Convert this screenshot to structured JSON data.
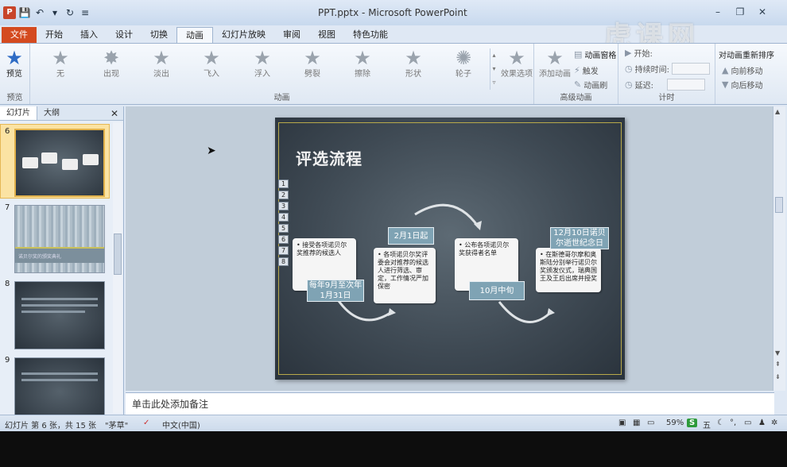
{
  "window": {
    "title": "PPT.pptx - Microsoft PowerPoint",
    "controls": [
      "–",
      "❐",
      "✕"
    ],
    "watermark": "虎课网"
  },
  "tabs": [
    "文件",
    "开始",
    "插入",
    "设计",
    "切换",
    "动画",
    "幻灯片放映",
    "审阅",
    "视图",
    "特色功能"
  ],
  "active_tab": "动画",
  "ribbon": {
    "preview_label": "预览",
    "preview_group": "预览",
    "animation_group": "动画",
    "animations": [
      "无",
      "出现",
      "淡出",
      "飞入",
      "浮入",
      "劈裂",
      "擦除",
      "形状",
      "轮子"
    ],
    "effect_options": "效果选项",
    "advanced_group": "高级动画",
    "add_animation": "添加动画",
    "animation_pane": "动画窗格",
    "trigger": "触发",
    "animation_painter": "动画刷",
    "timing_group": "计时",
    "start_label": "开始:",
    "duration_label": "持续时间:",
    "delay_label": "延迟:",
    "reorder_title": "对动画重新排序",
    "move_earlier": "向前移动",
    "move_later": "向后移动"
  },
  "left_panel": {
    "tab_slides": "幻灯片",
    "tab_outline": "大纲",
    "thumbs": [
      {
        "num": "6",
        "selected": true
      },
      {
        "num": "7",
        "selected": false,
        "caption": "诺贝尔奖的颁奖典礼"
      },
      {
        "num": "8",
        "selected": false
      },
      {
        "num": "9",
        "selected": false
      }
    ]
  },
  "slide": {
    "title": "评选流程",
    "anim_tags": [
      "1",
      "2",
      "3",
      "4",
      "5",
      "6",
      "7",
      "8"
    ],
    "cards": [
      "• 接受各项诺贝尔奖推荐的候选人",
      "• 各项诺贝尔奖评委会对推荐的候选人进行筛选、审定，工作情况严加保密",
      "• 公布各项诺贝尔奖获得者名单",
      "• 在斯德哥尔摩和奥斯陆分别举行诺贝尔奖颁发仪式，瑞典国王及王后出席并授奖"
    ],
    "labels": [
      "每年9月至次年1月31日",
      "2月1日起",
      "10月中旬",
      "12月10日诺贝尔逝世纪念日"
    ]
  },
  "notes": {
    "placeholder": "单击此处添加备注"
  },
  "status": {
    "slide_info": "幻灯片 第 6 张，共 15 张",
    "theme": "\"茅草\"",
    "language": "中文(中国)",
    "zoom": "59%",
    "ime": "五"
  }
}
